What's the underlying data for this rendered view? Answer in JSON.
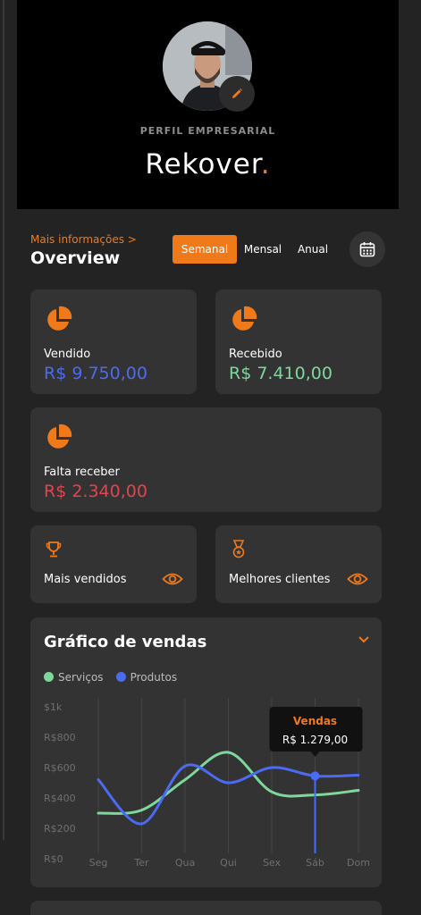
{
  "profile": {
    "label": "PERFIL EMPRESARIAL",
    "brand_name": "Rekover",
    "brand_dot": "."
  },
  "overview": {
    "more_info": "Mais informações >",
    "title": "Overview",
    "tabs": [
      "Semanal",
      "Mensal",
      "Anual"
    ],
    "active_tab": 0
  },
  "cards": {
    "sold": {
      "label": "Vendido",
      "value": "R$ 9.750,00"
    },
    "received": {
      "label": "Recebido",
      "value": "R$ 7.410,00"
    },
    "pending": {
      "label": "Falta receber",
      "value": "R$ 2.340,00"
    },
    "best_sellers": {
      "label": "Mais vendidos"
    },
    "best_clients": {
      "label": "Melhores clientes"
    }
  },
  "colors": {
    "accent": "#f07a1a",
    "blue": "#4b6bf0",
    "green": "#7ed89b",
    "red": "#e0454f"
  },
  "chart_data": {
    "type": "line",
    "title": "Gráfico de vendas",
    "categories": [
      "Seg",
      "Ter",
      "Qua",
      "Qui",
      "Sex",
      "Sáb",
      "Dom"
    ],
    "y_ticks": [
      "R$0",
      "R$200",
      "R$400",
      "R$600",
      "R$800",
      "$1k"
    ],
    "ylim": [
      0,
      1000
    ],
    "series": [
      {
        "name": "Serviços",
        "color": "#7ed89b",
        "values": [
          300,
          320,
          520,
          700,
          440,
          420,
          450
        ]
      },
      {
        "name": "Produtos",
        "color": "#4b6bf0",
        "values": [
          520,
          230,
          610,
          500,
          600,
          545,
          550
        ]
      }
    ],
    "tooltip": {
      "title": "Vendas",
      "value": "R$ 1.279,00",
      "category": "Sáb"
    }
  }
}
